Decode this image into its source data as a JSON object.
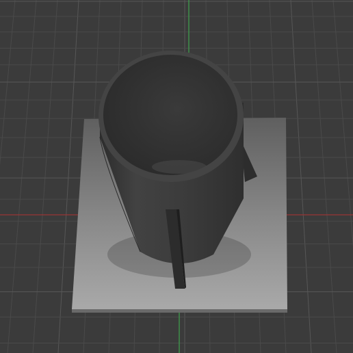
{
  "viewport": {
    "background": "#3b3b3b",
    "grid_minor_color": "#4a4a4a",
    "grid_major_color": "#575757",
    "axis_x_color": "#b23a3a",
    "axis_y_color": "#3fa34d"
  },
  "model": {
    "base_plate_color": "#8f8f8f",
    "cylinder_color": "#3d3d3d",
    "cylinder_rim_color": "#4a4a4a",
    "fin_color": "#2e2e2e"
  },
  "labels": {}
}
